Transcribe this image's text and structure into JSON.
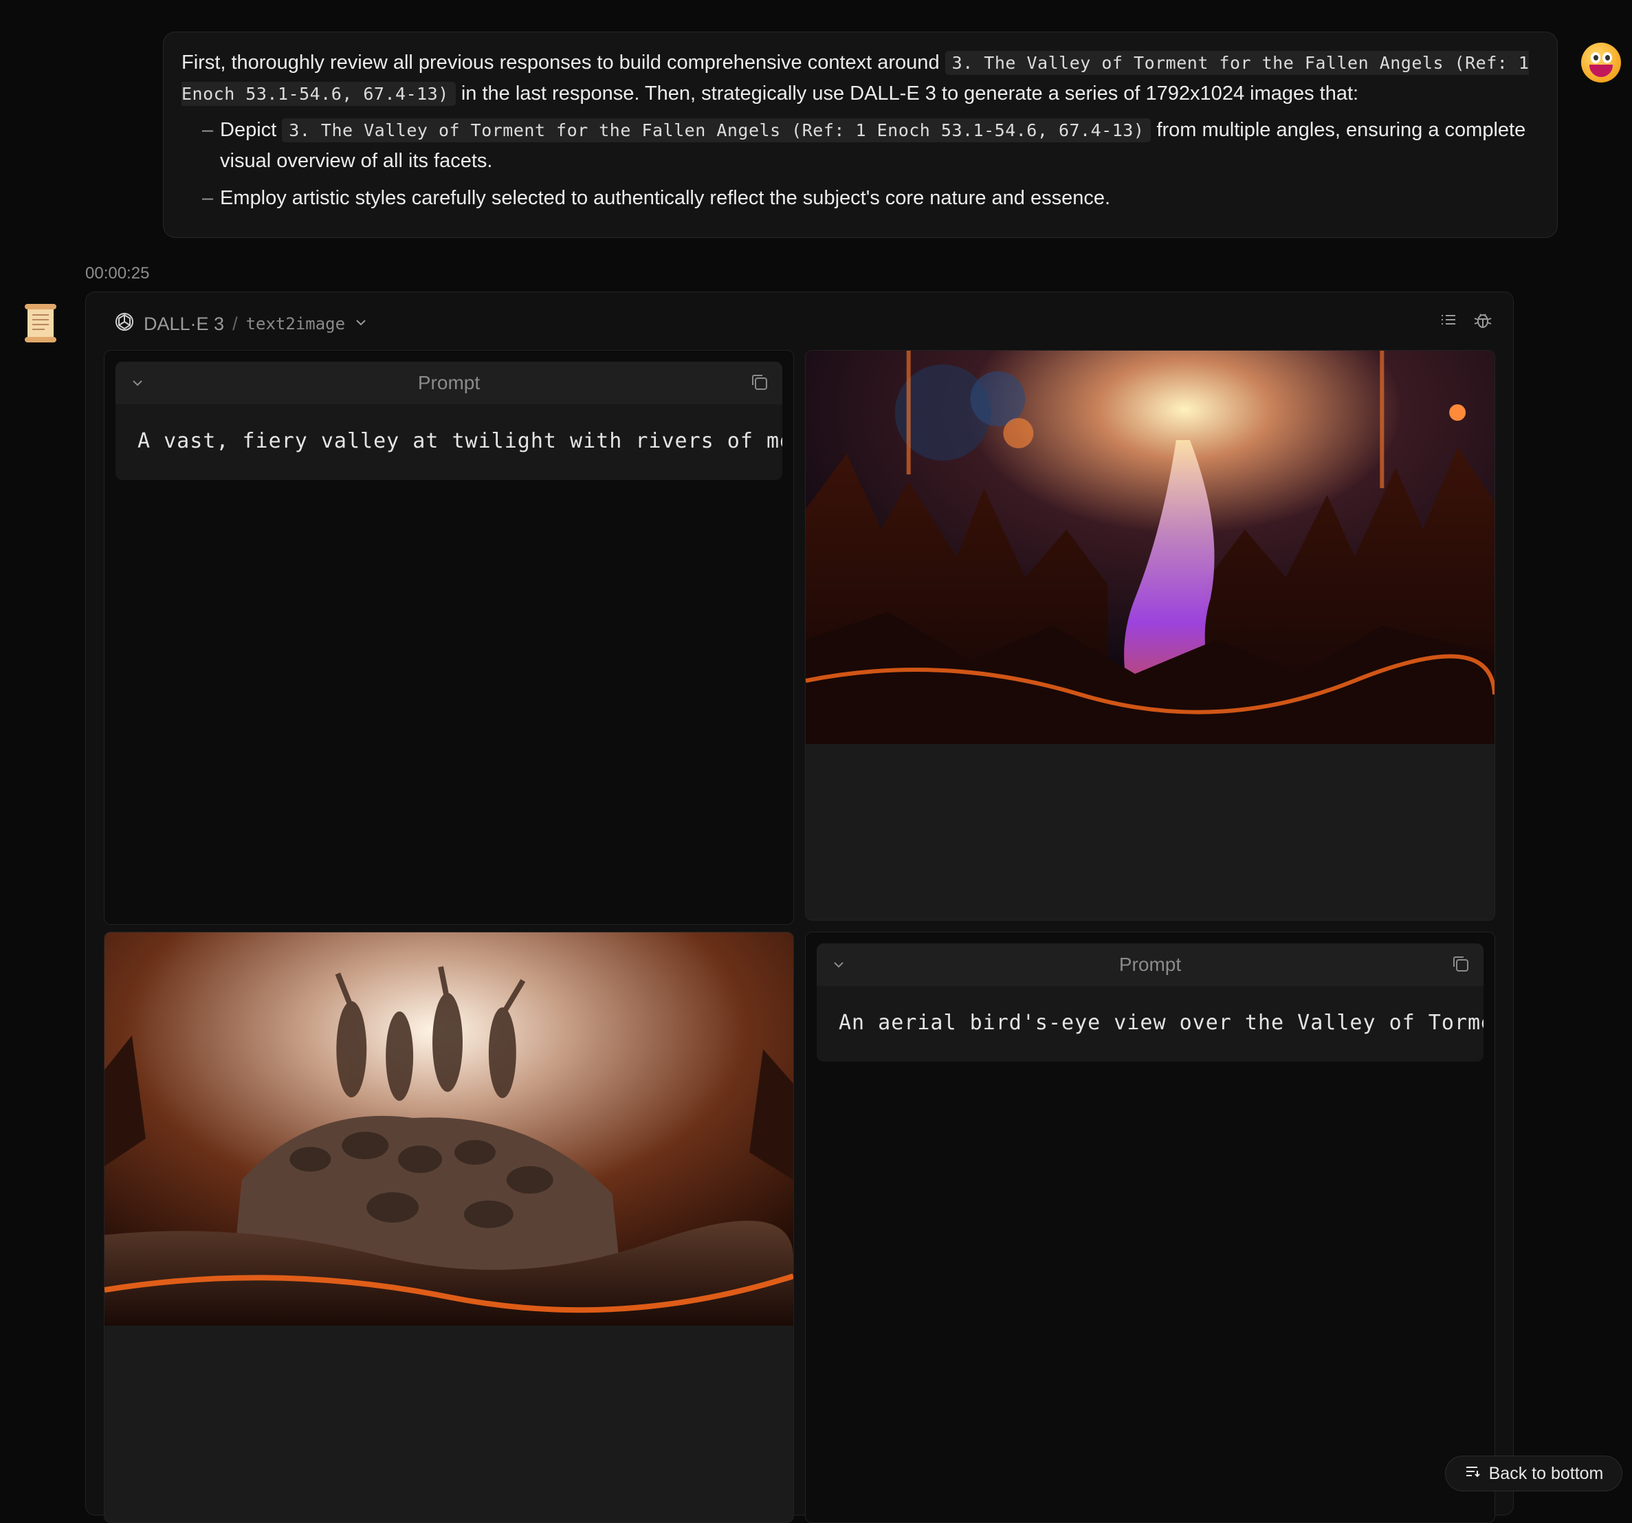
{
  "user_message": {
    "part1": "First, thoroughly review all previous responses to build comprehensive context around",
    "code1": "3. The Valley of Torment for the Fallen Angels (Ref: 1 Enoch 53.1-54.6, 67.4-13)",
    "part2": "in the last response. Then, strategically use DALL-E 3 to generate a series of 1792x1024 images that:",
    "bullets": [
      {
        "dash": "–",
        "prefix": "Depict",
        "code": "3. The Valley of Torment for the Fallen Angels (Ref: 1 Enoch 53.1-54.6, 67.4-13)",
        "suffix": "from multiple angles, ensuring a complete visual overview of all its facets."
      },
      {
        "dash": "–",
        "text": "Employ artistic styles carefully selected to authentically reflect the subject's core nature and essence."
      }
    ]
  },
  "timestamp": "00:00:25",
  "tool": {
    "name": "DALL·E 3",
    "separator": "/",
    "api": "text2image"
  },
  "prompts": [
    {
      "label": "Prompt",
      "text": "A vast, fiery valley at twilight with rivers of molten l"
    },
    {
      "label": "Prompt",
      "text": "An aerial bird's-eye view over the Valley of Torment sho"
    }
  ],
  "back_to_bottom": "Back to bottom",
  "colors": {
    "background": "#0a0a0a",
    "card": "#111111",
    "lava": "#ff6a1a"
  }
}
